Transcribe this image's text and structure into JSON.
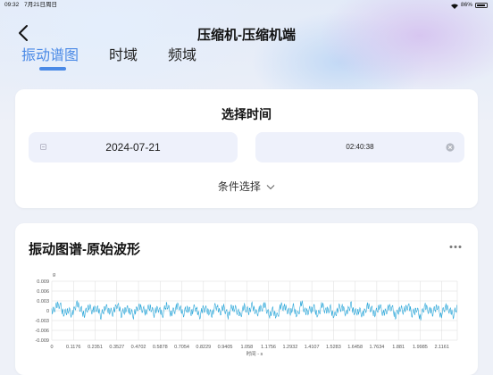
{
  "status_bar": {
    "time": "09:32",
    "date": "7月21日周日",
    "battery": "86%"
  },
  "header": {
    "title": "压缩机-压缩机端",
    "tabs": [
      "振动谱图",
      "时域",
      "频域"
    ],
    "active_tab": 0
  },
  "time_selector": {
    "title": "选择时间",
    "date_value": "2024-07-21",
    "time_value": "02:40:38",
    "filter_label": "条件选择"
  },
  "chart_card": {
    "title": "振动图谱-原始波形"
  },
  "colors": {
    "accent": "#4b8ae6",
    "series": "#29a6d9",
    "grid": "#dcdcdc"
  },
  "chart_data": {
    "type": "line",
    "title": "振动图谱-原始波形",
    "ylabel": "g",
    "xlabel": "时间 - s",
    "ylim": [
      -0.009,
      0.009
    ],
    "yticks": [
      "0.009",
      "0.006",
      "0.003",
      "0",
      "-0.003",
      "-0.006",
      "-0.009"
    ],
    "xlim": [
      0,
      2.2
    ],
    "xticks": [
      "0",
      "0.1176",
      "0.2351",
      "0.3527",
      "0.4702",
      "0.5878",
      "0.7054",
      "0.8229",
      "0.9405",
      "1.058",
      "1.1756",
      "1.2932",
      "1.4107",
      "1.5283",
      "1.6458",
      "1.7634",
      "1.881",
      "1.9985",
      "2.1161"
    ],
    "grid": true,
    "series": [
      {
        "x_start": 0,
        "x_end": 2.2,
        "values": [
          -0.0007,
          0.0012,
          0.0018,
          -0.0009,
          0.0004,
          -0.0014,
          0.0021,
          0.0006,
          -0.0011,
          0.0015,
          -0.0003,
          0.0009,
          -0.0017,
          0.0013,
          0.0002,
          -0.0008,
          0.0019,
          -0.0012,
          0.0007,
          0.0003,
          -0.0016,
          0.0011,
          0.0005,
          -0.0002,
          0.0014,
          -0.001,
          0.0008,
          -0.0015,
          0.0022,
          -0.0006,
          0.0001,
          0.0016,
          -0.0013,
          0.001,
          -0.0004,
          0.0012,
          -0.0019,
          0.0006,
          0.0003,
          -0.0011,
          0.0017,
          -0.0007,
          0.0009,
          -0.0014,
          0.0013,
          0.0004,
          -0.0016,
          0.0011,
          -0.0002,
          0.0018,
          -0.0009,
          0.0005,
          0.0015,
          -0.0012,
          0.0002,
          -0.0018,
          0.0014,
          0.0007,
          -0.0005,
          0.0012,
          -0.0015,
          0.0023,
          -0.0008,
          0.0003,
          0.001,
          -0.0013,
          0.0016,
          -0.0004,
          0.0008,
          -0.0017,
          0.0011,
          0.0006,
          -0.001,
          0.0019,
          -0.0006,
          0.0002,
          -0.0014,
          0.0013,
          0.0005,
          -0.0009,
          0.0017,
          -0.0012,
          0.0004,
          0.0011,
          -0.0016,
          0.0009,
          -0.0003,
          0.0015,
          -0.0011,
          0.0007,
          -0.0019,
          0.0012,
          0.0001,
          -0.0007,
          0.0016,
          -0.0013,
          0.001,
          0.0003,
          -0.0015,
          0.0014
        ]
      }
    ]
  }
}
